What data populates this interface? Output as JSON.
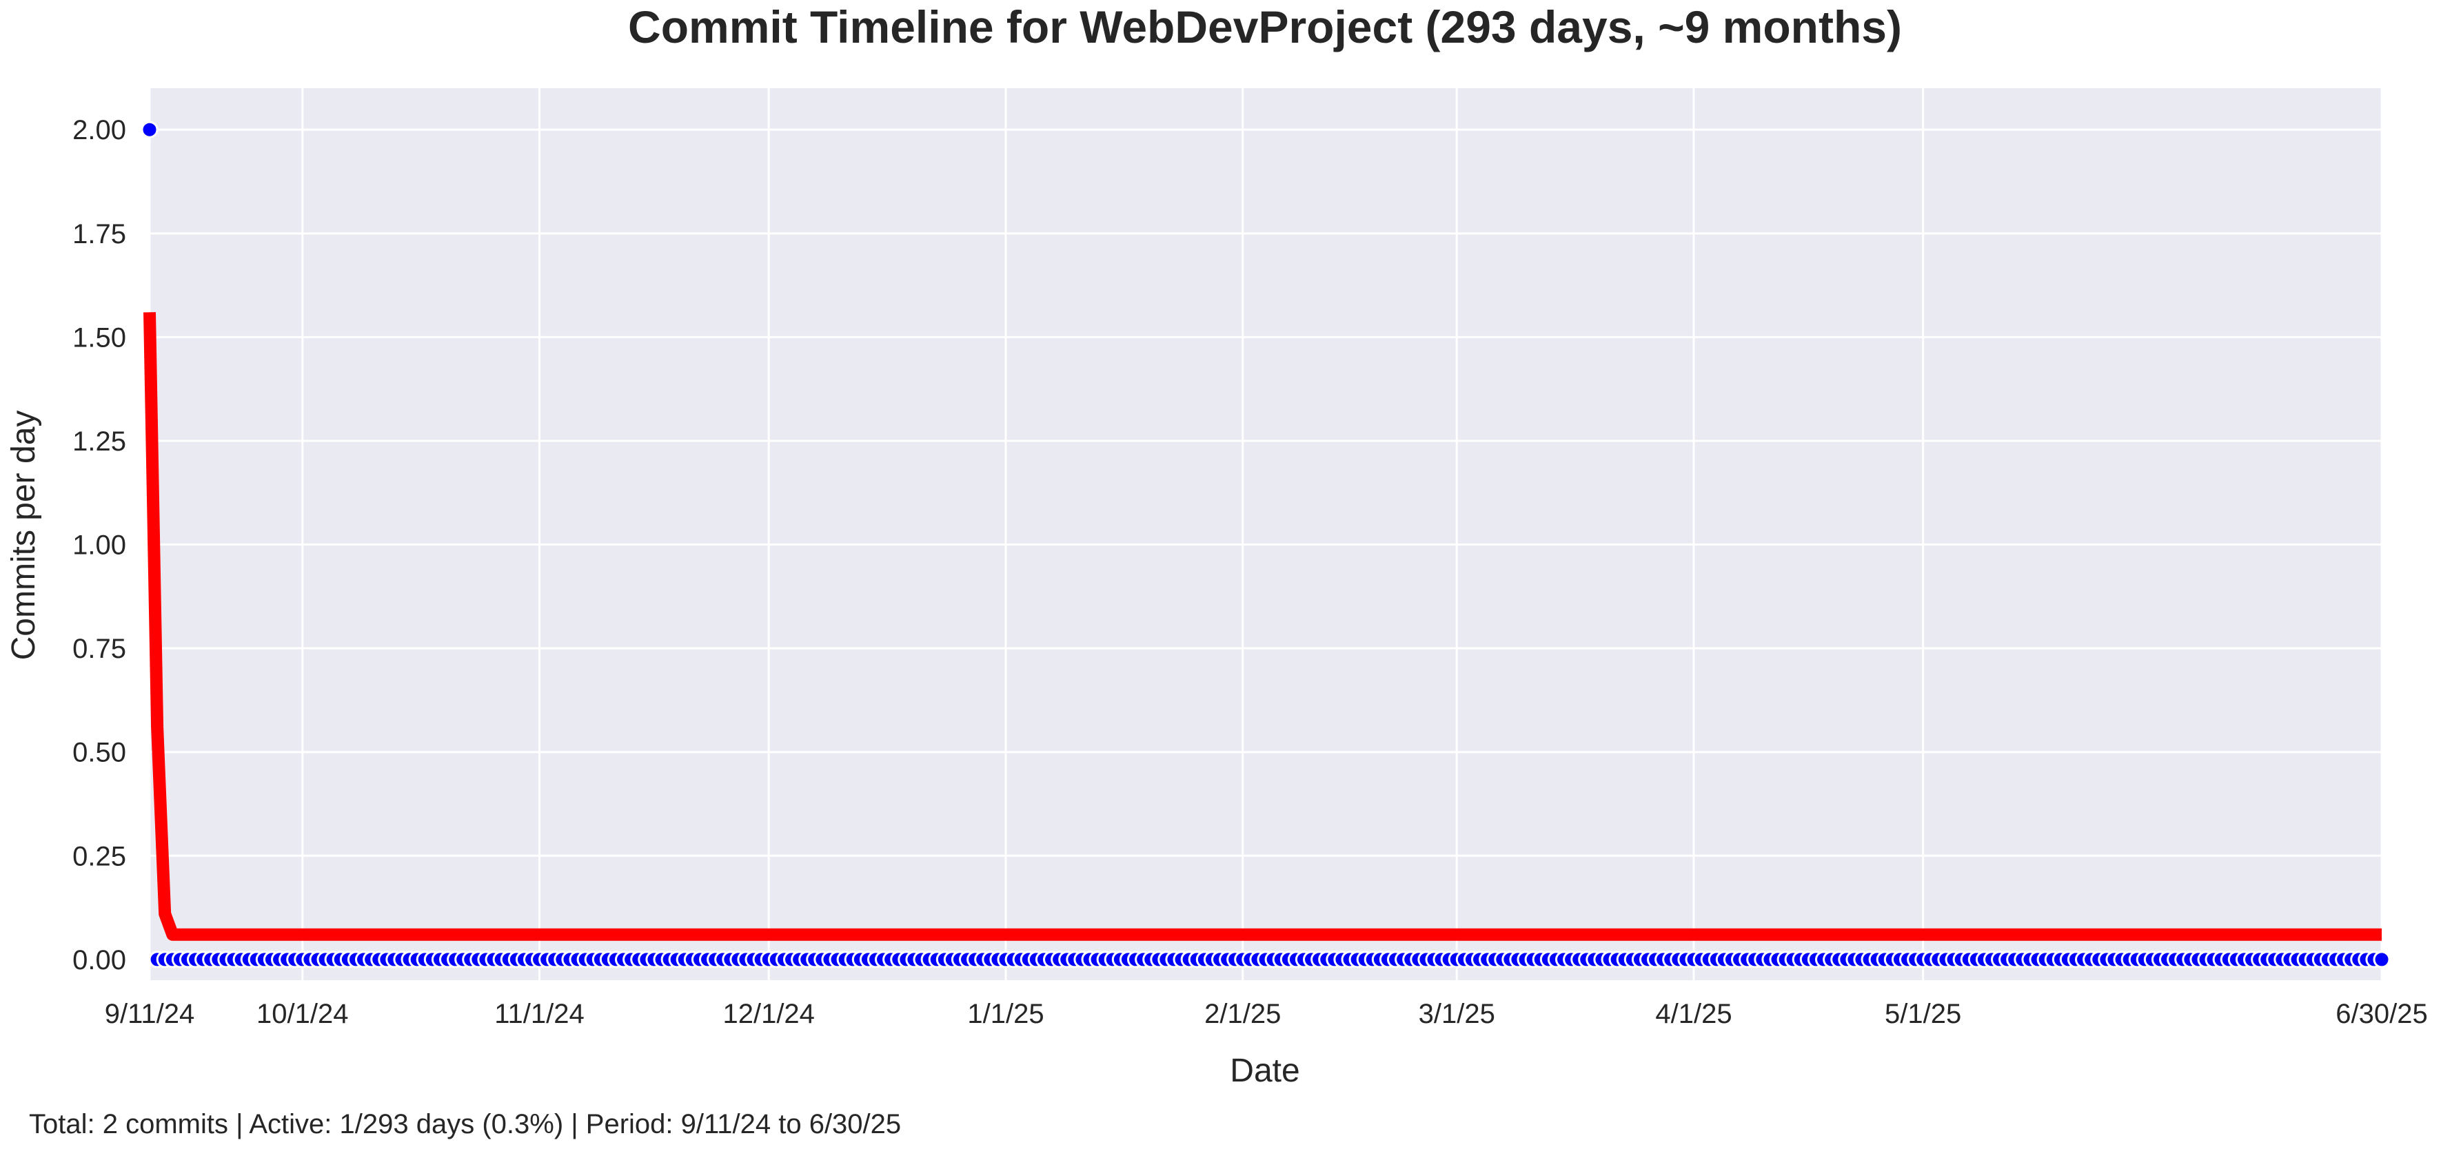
{
  "chart_data": {
    "type": "line",
    "title": "Commit Timeline for WebDevProject (293 days, ~9 months)",
    "xlabel": "Date",
    "ylabel": "Commits per day",
    "footer": "Total: 2 commits | Active: 1/293 days (0.3%) | Period: 9/11/24 to 6/30/25",
    "x_range": [
      "2024-09-11",
      "2025-06-30"
    ],
    "ylim": [
      -0.05,
      2.1
    ],
    "grid": true,
    "legend": "none",
    "x_ticks": [
      {
        "date": "2024-09-11",
        "label": "9/11/24"
      },
      {
        "date": "2024-10-01",
        "label": "10/1/24"
      },
      {
        "date": "2024-11-01",
        "label": "11/1/24"
      },
      {
        "date": "2024-12-01",
        "label": "12/1/24"
      },
      {
        "date": "2025-01-01",
        "label": "1/1/25"
      },
      {
        "date": "2025-02-01",
        "label": "2/1/25"
      },
      {
        "date": "2025-03-01",
        "label": "3/1/25"
      },
      {
        "date": "2025-04-01",
        "label": "4/1/25"
      },
      {
        "date": "2025-05-01",
        "label": "5/1/25"
      },
      {
        "date": "2025-06-30",
        "label": "6/30/25"
      }
    ],
    "y_ticks": [
      {
        "value": 0.0,
        "label": "0.00"
      },
      {
        "value": 0.25,
        "label": "0.25"
      },
      {
        "value": 0.5,
        "label": "0.50"
      },
      {
        "value": 0.75,
        "label": "0.75"
      },
      {
        "value": 1.0,
        "label": "1.00"
      },
      {
        "value": 1.25,
        "label": "1.25"
      },
      {
        "value": 1.5,
        "label": "1.50"
      },
      {
        "value": 1.75,
        "label": "1.75"
      },
      {
        "value": 2.0,
        "label": "2.00"
      }
    ],
    "series": [
      {
        "kind": "scatter",
        "color": "#0000ff",
        "start_date": "2024-09-11",
        "end_date": "2025-06-30",
        "default_value": 0,
        "nonzero": [
          {
            "date": "2024-09-11",
            "value": 2
          }
        ]
      },
      {
        "kind": "line",
        "color": "#ff0000",
        "points": [
          {
            "date": "2024-09-11",
            "value": 1.56
          },
          {
            "date": "2024-09-12",
            "value": 0.56
          },
          {
            "date": "2024-09-13",
            "value": 0.11
          },
          {
            "date": "2024-09-14",
            "value": 0.06
          },
          {
            "date": "2025-06-30",
            "value": 0.06
          }
        ]
      }
    ],
    "colors": {
      "plot_background": "#eaeaf2",
      "grid": "#ffffff",
      "text": "#262626"
    }
  }
}
